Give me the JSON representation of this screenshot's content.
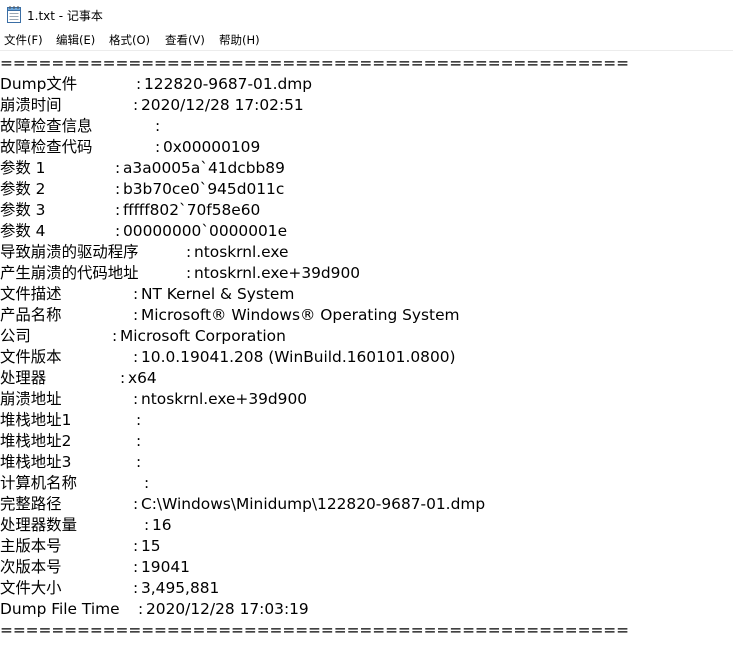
{
  "window": {
    "title": "1.txt - 记事本",
    "icon": "notepad-icon"
  },
  "menu": [
    {
      "label": "文件(F)"
    },
    {
      "label": "编辑(E)"
    },
    {
      "label": "格式(O)"
    },
    {
      "label": "查看(V)"
    },
    {
      "label": "帮助(H)"
    }
  ],
  "document": {
    "rule_top": "=================================================",
    "rule_bottom": "=================================================",
    "rows": [
      {
        "label": "Dump文件",
        "value": "122820-9687-01.dmp"
      },
      {
        "label": "崩溃时间",
        "value": "2020/12/28 17:02:51"
      },
      {
        "label": "故障检查信息",
        "value": ""
      },
      {
        "label": "故障检查代码",
        "value": "0x00000109"
      },
      {
        "label": "参数 1",
        "value": "a3a0005a`41dcbb89"
      },
      {
        "label": "参数 2",
        "value": "b3b70ce0`945d011c"
      },
      {
        "label": "参数 3",
        "value": "fffff802`70f58e60"
      },
      {
        "label": "参数 4",
        "value": "00000000`0000001e"
      },
      {
        "label": "导致崩溃的驱动程序",
        "value": "ntoskrnl.exe"
      },
      {
        "label": "产生崩溃的代码地址",
        "value": "ntoskrnl.exe+39d900"
      },
      {
        "label": "文件描述",
        "value": "NT Kernel & System"
      },
      {
        "label": "产品名称",
        "value": "Microsoft® Windows® Operating System"
      },
      {
        "label": "公司",
        "value": "Microsoft Corporation"
      },
      {
        "label": "文件版本",
        "value": "10.0.19041.208 (WinBuild.160101.0800)"
      },
      {
        "label": "处理器",
        "value": "x64"
      },
      {
        "label": "崩溃地址",
        "value": "ntoskrnl.exe+39d900"
      },
      {
        "label": "堆栈地址1",
        "value": ""
      },
      {
        "label": "堆栈地址2",
        "value": ""
      },
      {
        "label": "堆栈地址3",
        "value": ""
      },
      {
        "label": "计算机名称",
        "value": ""
      },
      {
        "label": "完整路径",
        "value": "C:\\Windows\\Minidump\\122820-9687-01.dmp"
      },
      {
        "label": "处理器数量",
        "value": "16"
      },
      {
        "label": "主版本号",
        "value": "15"
      },
      {
        "label": "次版本号",
        "value": "19041"
      },
      {
        "label": "文件大小",
        "value": "3,495,881"
      },
      {
        "label": "Dump File Time",
        "value": "2020/12/28 17:03:19"
      }
    ]
  }
}
